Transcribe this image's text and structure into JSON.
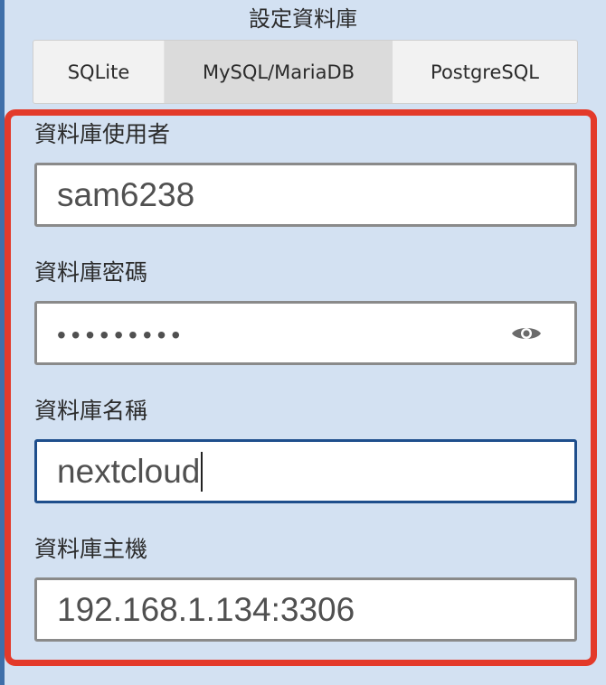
{
  "section": {
    "title": "設定資料庫"
  },
  "tabs": [
    {
      "label": "SQLite",
      "selected": false
    },
    {
      "label": "MySQL/MariaDB",
      "selected": true
    },
    {
      "label": "PostgreSQL",
      "selected": false
    }
  ],
  "fields": {
    "db_user": {
      "label": "資料庫使用者",
      "value": "sam6238"
    },
    "db_password": {
      "label": "資料庫密碼",
      "masked_value": "•••••••••",
      "toggle_icon": "eye-icon"
    },
    "db_name": {
      "label": "資料庫名稱",
      "value": "nextcloud",
      "focused": true
    },
    "db_host": {
      "label": "資料庫主機",
      "value": "192.168.1.134:3306"
    }
  },
  "colors": {
    "background": "#d3e1f2",
    "highlight_border": "#e33a2a",
    "focused_border": "#1e4e8c",
    "selected_tab": "#dbdbdb",
    "left_edge": "#3f6fa9"
  }
}
